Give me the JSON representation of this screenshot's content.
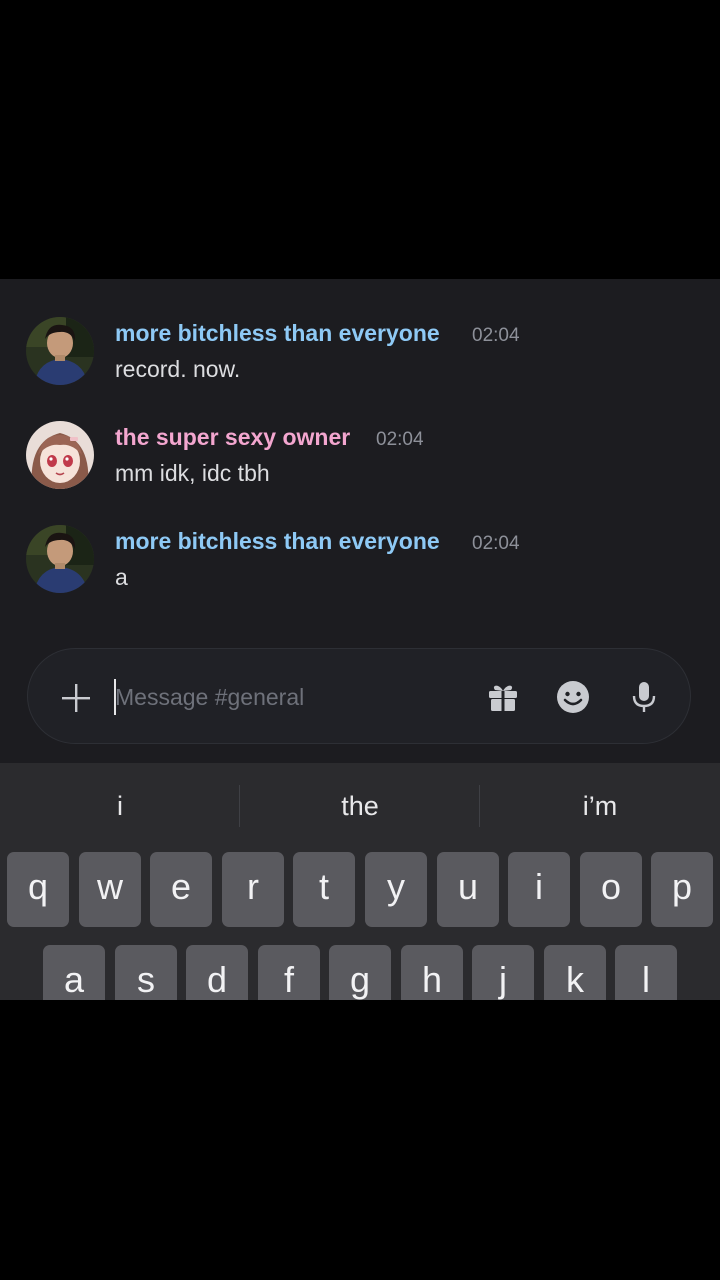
{
  "chat": {
    "messages": [
      {
        "author": "more bitchless than everyone",
        "time": "02:04",
        "text": "record. now.",
        "name_color": "#8ec9f5"
      },
      {
        "author": "the super sexy owner",
        "time": "02:04",
        "text": "mm idk, idc tbh",
        "name_color": "#f3a6cf"
      },
      {
        "author": "more bitchless than everyone",
        "time": "02:04",
        "text": "a",
        "name_color": "#8ec9f5"
      }
    ]
  },
  "composer": {
    "placeholder": "Message #general",
    "icons": [
      "plus-icon",
      "gift-icon",
      "emoji-icon",
      "microphone-icon"
    ]
  },
  "keyboard": {
    "suggestions": [
      "i",
      "the",
      "i’m"
    ],
    "row1": [
      "q",
      "w",
      "e",
      "r",
      "t",
      "y",
      "u",
      "i",
      "o",
      "p"
    ],
    "row2": [
      "a",
      "s",
      "d",
      "f",
      "g",
      "h",
      "j",
      "k",
      "l"
    ]
  },
  "colors": {
    "background": "#1c1c20",
    "composer_bg": "#202126",
    "keyboard_bg": "#2b2b2e",
    "key_bg": "#5a5a5f"
  }
}
